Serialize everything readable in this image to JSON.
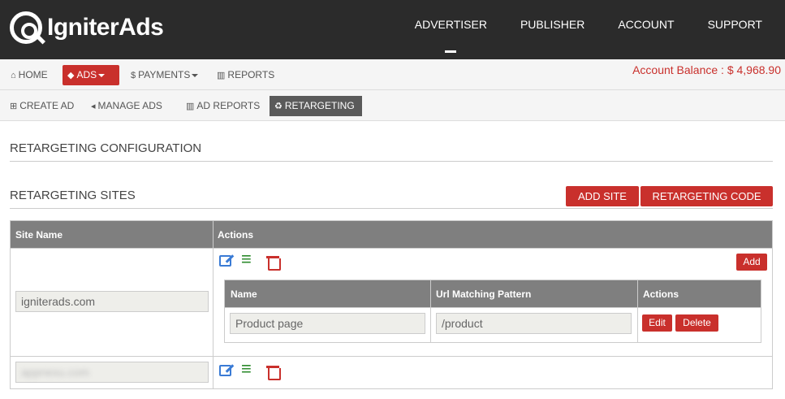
{
  "brand": {
    "logo_text_1": "Igniter",
    "logo_text_2": "Ads"
  },
  "main_nav": {
    "items": [
      "ADVERTISER",
      "PUBLISHER",
      "ACCOUNT",
      "SUPPORT"
    ]
  },
  "sub_nav": {
    "home": "HOME",
    "ads": "ADS",
    "payments": "PAYMENTS",
    "reports": "REPORTS",
    "balance": "Account Balance : $ 4,968.90"
  },
  "tert_nav": {
    "create_ad": "CREATE AD",
    "manage_ads": "MANAGE ADS",
    "ad_reports": "AD REPORTS",
    "retargeting": "RETARGETING"
  },
  "section_config": {
    "title": "RETARGETING CONFIGURATION"
  },
  "section_sites": {
    "title": "RETARGETING SITES",
    "add_site": "ADD SITE",
    "retargeting_code": "RETARGETING CODE"
  },
  "sites_table": {
    "headers": {
      "site_name": "Site Name",
      "actions": "Actions"
    },
    "rows": [
      {
        "site": "igniterads.com",
        "add_label": "Add"
      },
      {
        "site": "appnexu.com"
      }
    ]
  },
  "patterns_table": {
    "headers": {
      "name": "Name",
      "url_pattern": "Url Matching Pattern",
      "actions": "Actions"
    },
    "rows": [
      {
        "name": "Product page",
        "pattern": "/product",
        "edit": "Edit",
        "delete": "Delete"
      }
    ]
  },
  "colors": {
    "accent": "#c9302c",
    "topbar": "#2b2b2b",
    "header_gray": "#7f7f7f"
  }
}
